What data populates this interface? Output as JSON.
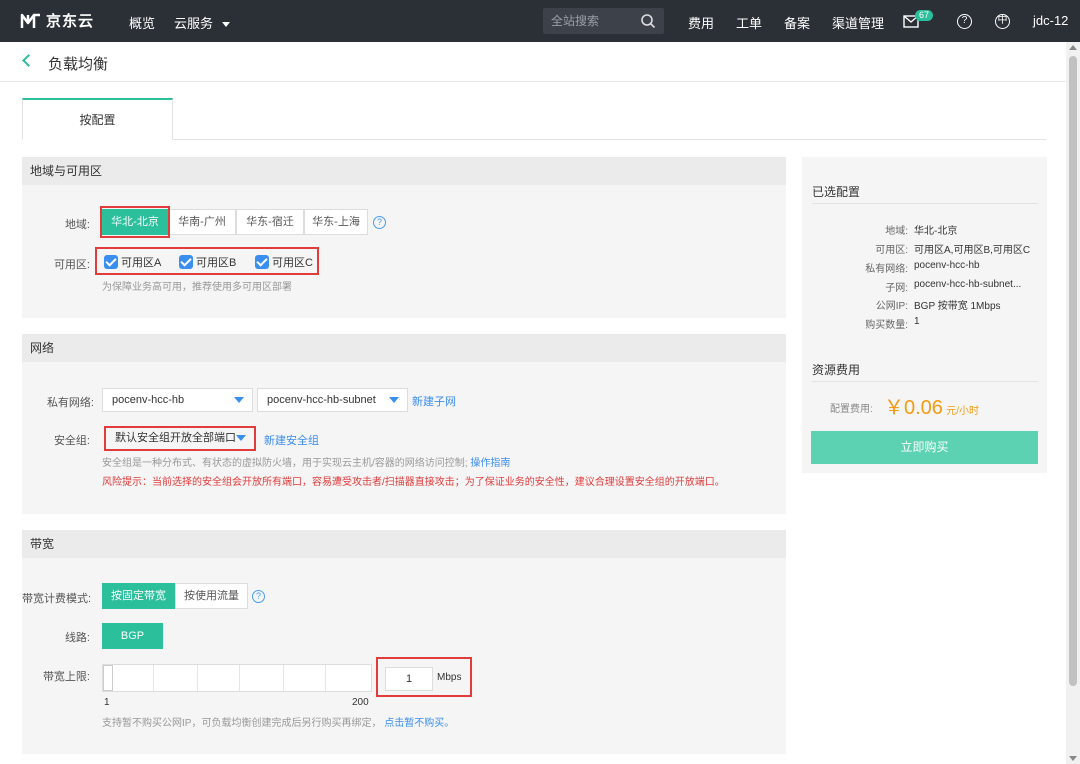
{
  "topnav": {
    "brand": "京东云",
    "items": [
      "概览",
      "云服务"
    ],
    "search_placeholder": "全站搜索",
    "links": [
      "费用",
      "工单",
      "备案",
      "渠道管理"
    ],
    "message_count": "67",
    "help_glyph": "?",
    "lang_glyph": "中",
    "user": "jdc-12"
  },
  "page": {
    "title": "负载均衡"
  },
  "tabs": [
    "按配置"
  ],
  "region_panel": {
    "title": "地域与可用区",
    "region_label": "地域:",
    "regions": [
      "华北-北京",
      "华南-广州",
      "华东-宿迁",
      "华东-上海"
    ],
    "zone_label": "可用区:",
    "zones": [
      "可用区A",
      "可用区B",
      "可用区C"
    ],
    "zone_hint": "为保障业务高可用，推荐使用多可用区部署"
  },
  "network_panel": {
    "title": "网络",
    "vpc_label": "私有网络:",
    "vpc_value": "pocenv-hcc-hb",
    "subnet_value": "pocenv-hcc-hb-subnet",
    "new_subnet": "新建子网",
    "sg_label": "安全组:",
    "sg_value": "默认安全组开放全部端口",
    "new_sg": "新建安全组",
    "sg_hint": "安全组是一种分布式、有状态的虚拟防火墙，用于实现云主机/容器的网络访问控制;",
    "sg_hint_link": "操作指南",
    "risk": "风险提示：当前选择的安全组会开放所有端口，容易遭受攻击者/扫描器直接攻击；为了保证业务的安全性，建议合理设置安全组的开放端口。"
  },
  "bandwidth_panel": {
    "title": "带宽",
    "mode_label": "带宽计费模式:",
    "modes": [
      "按固定带宽",
      "按使用流量"
    ],
    "line_label": "线路:",
    "line_value": "BGP",
    "limit_label": "带宽上限:",
    "min": "1",
    "max": "200",
    "value": "1",
    "unit": "Mbps",
    "hint": "支持暂不购买公网IP，可负载均衡创建完成后另行购买再绑定，",
    "hint_link": "点击暂不购买。"
  },
  "summary": {
    "title": "已选配置",
    "rows": [
      {
        "k": "地域:",
        "v": "华北-北京"
      },
      {
        "k": "可用区:",
        "v": "可用区A,可用区B,可用区C"
      },
      {
        "k": "私有网络:",
        "v": "pocenv-hcc-hb"
      },
      {
        "k": "子网:",
        "v": "pocenv-hcc-hb-subnet..."
      },
      {
        "k": "公网IP:",
        "v": "BGP 按带宽 1Mbps"
      },
      {
        "k": "购买数量:",
        "v": "1"
      }
    ],
    "fee_title": "资源费用",
    "fee_label": "配置费用:",
    "price": "￥0.06",
    "price_unit": "元/小时",
    "buy": "立即购买"
  },
  "colors": {
    "accent": "#2bbf9b",
    "nav_bg": "#2b2f36",
    "danger": "#e23b3b",
    "link": "#3a8ef0",
    "price": "#f39c12"
  }
}
